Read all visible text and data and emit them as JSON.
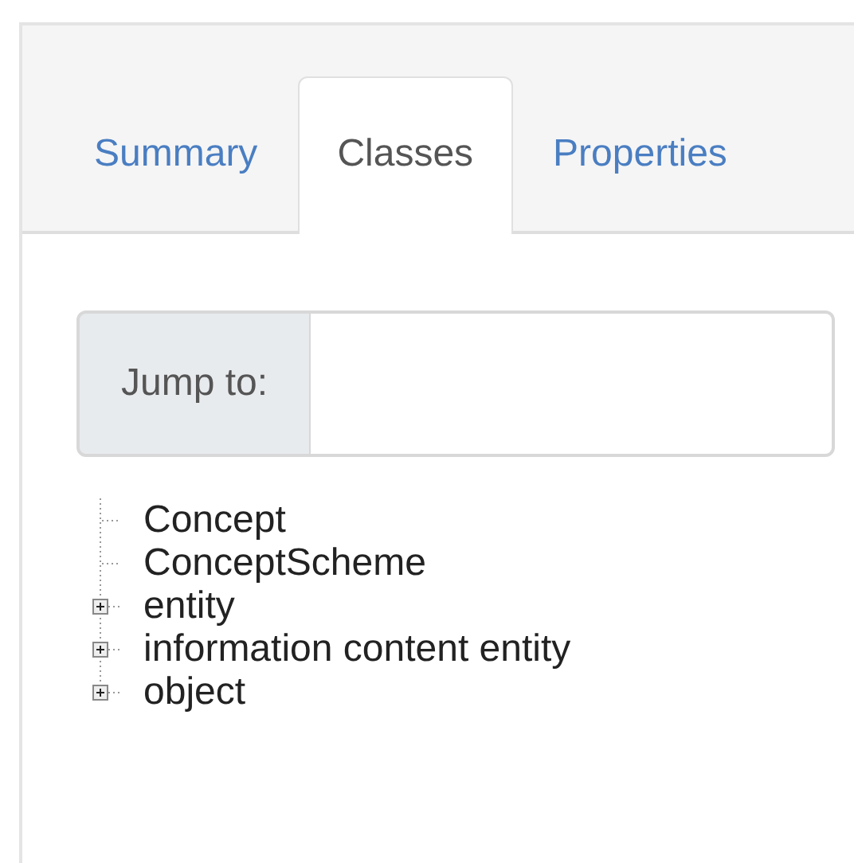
{
  "tabs": [
    {
      "label": "Summary",
      "selected": false
    },
    {
      "label": "Classes",
      "selected": true
    },
    {
      "label": "Properties",
      "selected": false
    }
  ],
  "jump": {
    "label": "Jump to:"
  },
  "tree": [
    {
      "label": "Concept",
      "kind": "leaf"
    },
    {
      "label": "ConceptScheme",
      "kind": "leaf"
    },
    {
      "label": "entity",
      "kind": "folder",
      "expanded": false
    },
    {
      "label": "information content entity",
      "kind": "folder",
      "expanded": false
    },
    {
      "label": "object",
      "kind": "folder",
      "expanded": false
    }
  ]
}
